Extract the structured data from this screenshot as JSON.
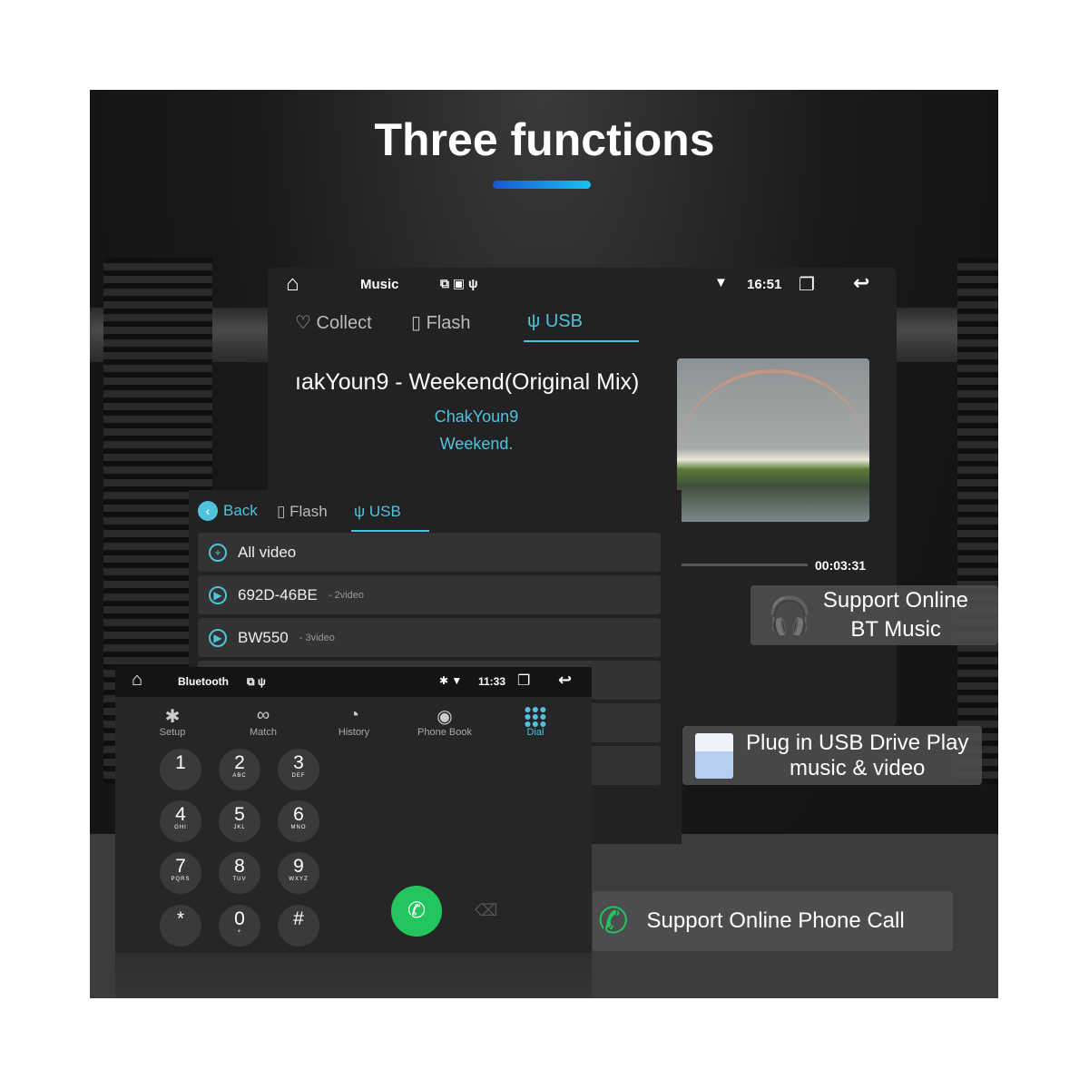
{
  "headline": "Three functions",
  "accent_colors": {
    "cyan": "#4fc3dc",
    "green": "#22c55e",
    "bar_start": "#1a55d6",
    "bar_end": "#19c2ee"
  },
  "music": {
    "status": {
      "title": "Music",
      "time": "16:51"
    },
    "tabs": [
      {
        "label": "Collect",
        "icon": "heart-icon"
      },
      {
        "label": "Flash",
        "icon": "sd-card-icon"
      },
      {
        "label": "USB",
        "icon": "usb-icon",
        "active": true
      }
    ],
    "track_title": "ıakYoun9 - Weekend(Original Mix)",
    "artist": "ChakYoun9",
    "album": "Weekend.",
    "elapsed": "00:03:31"
  },
  "video": {
    "back": "Back",
    "tabs": [
      {
        "label": "Flash"
      },
      {
        "label": "USB",
        "active": true
      }
    ],
    "rows": [
      {
        "name": "All video",
        "count": ""
      },
      {
        "name": "692D-46BE",
        "count": "- 2video"
      },
      {
        "name": "BW550",
        "count": "- 3video"
      }
    ]
  },
  "bluetooth": {
    "status": {
      "title": "Bluetooth",
      "time": "11:33"
    },
    "tabs": [
      {
        "label": "Setup",
        "icon": "bluetooth-icon"
      },
      {
        "label": "Match",
        "icon": "link-icon"
      },
      {
        "label": "History",
        "icon": "clock-icon"
      },
      {
        "label": "Phone Book",
        "icon": "contact-icon"
      },
      {
        "label": "Dial",
        "icon": "dialpad-icon",
        "active": true
      }
    ],
    "keys": [
      {
        "d": "1",
        "l": ""
      },
      {
        "d": "2",
        "l": "ABC"
      },
      {
        "d": "3",
        "l": "DEF"
      },
      {
        "d": "4",
        "l": "GHI"
      },
      {
        "d": "5",
        "l": "JKL"
      },
      {
        "d": "6",
        "l": "MNO"
      },
      {
        "d": "7",
        "l": "PQRS"
      },
      {
        "d": "8",
        "l": "TUV"
      },
      {
        "d": "9",
        "l": "WXYZ"
      },
      {
        "d": "*",
        "l": ""
      },
      {
        "d": "0",
        "l": "+"
      },
      {
        "d": "#",
        "l": ""
      }
    ]
  },
  "badges": {
    "bt_music_1": "Support Online",
    "bt_music_2": "BT Music",
    "usb_1": "Plug in USB Drive Play",
    "usb_2": "music & video",
    "phone": "Support Online Phone Call"
  }
}
